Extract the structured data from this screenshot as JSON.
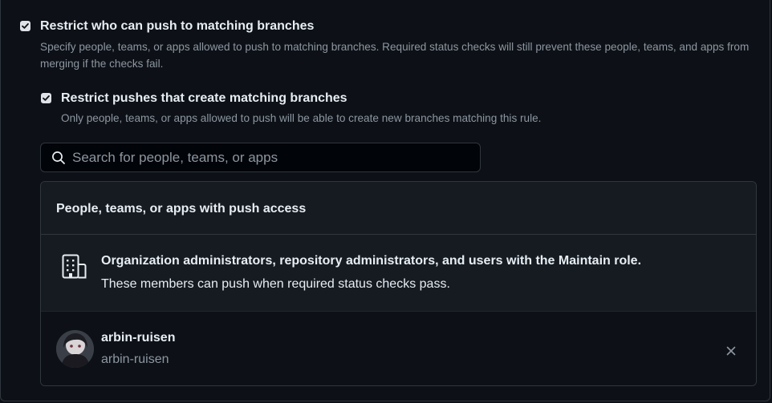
{
  "restrict_push": {
    "checked": true,
    "title": "Restrict who can push to matching branches",
    "description": "Specify people, teams, or apps allowed to push to matching branches. Required status checks will still prevent these people, teams, and apps from merging if the checks fail."
  },
  "restrict_create": {
    "checked": true,
    "title": "Restrict pushes that create matching branches",
    "description": "Only people, teams, or apps allowed to push will be able to create new branches matching this rule."
  },
  "search": {
    "value": "",
    "placeholder": "Search for people, teams, or apps",
    "icon": "search-icon"
  },
  "push_access": {
    "header": "People, teams, or apps with push access",
    "admins": {
      "icon": "organization-icon",
      "title": "Organization administrators, repository administrators, and users with the Maintain role.",
      "description": "These members can push when required status checks pass."
    },
    "users": [
      {
        "name": "arbin-ruisen",
        "login": "arbin-ruisen",
        "remove_icon": "close-icon"
      }
    ]
  },
  "colors": {
    "background": "#0d1117",
    "panel": "#161b22",
    "border": "#30363d",
    "text": "#e6edf3",
    "muted": "#8d96a0"
  }
}
